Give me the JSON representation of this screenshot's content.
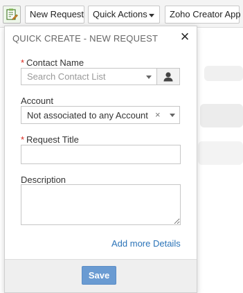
{
  "toolbar": {
    "icon": "notepad-edit-icon",
    "new_request_label": "New Request",
    "quick_actions_label": "Quick Actions",
    "zoho_label": "Zoho Creator App"
  },
  "popup": {
    "title": "QUICK CREATE - NEW REQUEST",
    "close_label": "×",
    "contact": {
      "label": "Contact Name",
      "required_mark": "*",
      "placeholder": "Search Contact List",
      "button_icon": "person-icon"
    },
    "account": {
      "label": "Account",
      "value": "Not associated to any Account",
      "clear_label": "×"
    },
    "request_title": {
      "label": "Request Title",
      "required_mark": "*",
      "value": ""
    },
    "description": {
      "label": "Description",
      "value": ""
    },
    "add_more_label": "Add more Details",
    "save_label": "Save"
  },
  "colors": {
    "accent_link": "#2a73b8",
    "save_button": "#6a9bd2",
    "required": "#d9261c"
  }
}
